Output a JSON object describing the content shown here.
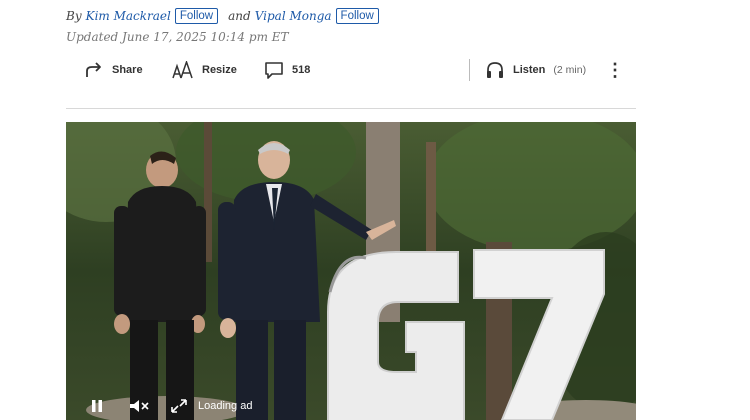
{
  "byline": {
    "prefix": "By",
    "authors": [
      {
        "name": "Kim Mackrael",
        "follow_label": "Follow"
      },
      {
        "name": "Vipal Monga",
        "follow_label": "Follow"
      }
    ],
    "joiner": "and"
  },
  "updated": "Updated June 17, 2025 10:14 pm ET",
  "toolbar": {
    "share_label": "Share",
    "resize_label": "Resize",
    "comments_count": "518",
    "listen_label": "Listen",
    "listen_duration": "(2 min)",
    "more_icon": "⋮"
  },
  "media": {
    "image_subject": "G7",
    "loading_label": "Loading ad",
    "icons": [
      "pause-icon",
      "mute-icon",
      "fullscreen-icon"
    ]
  },
  "colors": {
    "link": "#1e5aa8",
    "muted": "#777777",
    "rule": "#d8d8d8"
  }
}
